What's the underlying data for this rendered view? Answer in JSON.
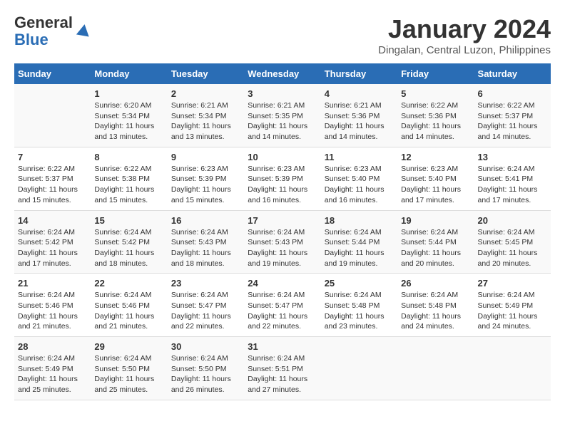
{
  "header": {
    "logo_line1": "General",
    "logo_line2": "Blue",
    "month_title": "January 2024",
    "location": "Dingalan, Central Luzon, Philippines"
  },
  "days_of_week": [
    "Sunday",
    "Monday",
    "Tuesday",
    "Wednesday",
    "Thursday",
    "Friday",
    "Saturday"
  ],
  "weeks": [
    [
      {
        "day": "",
        "info": ""
      },
      {
        "day": "1",
        "info": "Sunrise: 6:20 AM\nSunset: 5:34 PM\nDaylight: 11 hours\nand 13 minutes."
      },
      {
        "day": "2",
        "info": "Sunrise: 6:21 AM\nSunset: 5:34 PM\nDaylight: 11 hours\nand 13 minutes."
      },
      {
        "day": "3",
        "info": "Sunrise: 6:21 AM\nSunset: 5:35 PM\nDaylight: 11 hours\nand 14 minutes."
      },
      {
        "day": "4",
        "info": "Sunrise: 6:21 AM\nSunset: 5:36 PM\nDaylight: 11 hours\nand 14 minutes."
      },
      {
        "day": "5",
        "info": "Sunrise: 6:22 AM\nSunset: 5:36 PM\nDaylight: 11 hours\nand 14 minutes."
      },
      {
        "day": "6",
        "info": "Sunrise: 6:22 AM\nSunset: 5:37 PM\nDaylight: 11 hours\nand 14 minutes."
      }
    ],
    [
      {
        "day": "7",
        "info": "Sunrise: 6:22 AM\nSunset: 5:37 PM\nDaylight: 11 hours\nand 15 minutes."
      },
      {
        "day": "8",
        "info": "Sunrise: 6:22 AM\nSunset: 5:38 PM\nDaylight: 11 hours\nand 15 minutes."
      },
      {
        "day": "9",
        "info": "Sunrise: 6:23 AM\nSunset: 5:39 PM\nDaylight: 11 hours\nand 15 minutes."
      },
      {
        "day": "10",
        "info": "Sunrise: 6:23 AM\nSunset: 5:39 PM\nDaylight: 11 hours\nand 16 minutes."
      },
      {
        "day": "11",
        "info": "Sunrise: 6:23 AM\nSunset: 5:40 PM\nDaylight: 11 hours\nand 16 minutes."
      },
      {
        "day": "12",
        "info": "Sunrise: 6:23 AM\nSunset: 5:40 PM\nDaylight: 11 hours\nand 17 minutes."
      },
      {
        "day": "13",
        "info": "Sunrise: 6:24 AM\nSunset: 5:41 PM\nDaylight: 11 hours\nand 17 minutes."
      }
    ],
    [
      {
        "day": "14",
        "info": "Sunrise: 6:24 AM\nSunset: 5:42 PM\nDaylight: 11 hours\nand 17 minutes."
      },
      {
        "day": "15",
        "info": "Sunrise: 6:24 AM\nSunset: 5:42 PM\nDaylight: 11 hours\nand 18 minutes."
      },
      {
        "day": "16",
        "info": "Sunrise: 6:24 AM\nSunset: 5:43 PM\nDaylight: 11 hours\nand 18 minutes."
      },
      {
        "day": "17",
        "info": "Sunrise: 6:24 AM\nSunset: 5:43 PM\nDaylight: 11 hours\nand 19 minutes."
      },
      {
        "day": "18",
        "info": "Sunrise: 6:24 AM\nSunset: 5:44 PM\nDaylight: 11 hours\nand 19 minutes."
      },
      {
        "day": "19",
        "info": "Sunrise: 6:24 AM\nSunset: 5:44 PM\nDaylight: 11 hours\nand 20 minutes."
      },
      {
        "day": "20",
        "info": "Sunrise: 6:24 AM\nSunset: 5:45 PM\nDaylight: 11 hours\nand 20 minutes."
      }
    ],
    [
      {
        "day": "21",
        "info": "Sunrise: 6:24 AM\nSunset: 5:46 PM\nDaylight: 11 hours\nand 21 minutes."
      },
      {
        "day": "22",
        "info": "Sunrise: 6:24 AM\nSunset: 5:46 PM\nDaylight: 11 hours\nand 21 minutes."
      },
      {
        "day": "23",
        "info": "Sunrise: 6:24 AM\nSunset: 5:47 PM\nDaylight: 11 hours\nand 22 minutes."
      },
      {
        "day": "24",
        "info": "Sunrise: 6:24 AM\nSunset: 5:47 PM\nDaylight: 11 hours\nand 22 minutes."
      },
      {
        "day": "25",
        "info": "Sunrise: 6:24 AM\nSunset: 5:48 PM\nDaylight: 11 hours\nand 23 minutes."
      },
      {
        "day": "26",
        "info": "Sunrise: 6:24 AM\nSunset: 5:48 PM\nDaylight: 11 hours\nand 24 minutes."
      },
      {
        "day": "27",
        "info": "Sunrise: 6:24 AM\nSunset: 5:49 PM\nDaylight: 11 hours\nand 24 minutes."
      }
    ],
    [
      {
        "day": "28",
        "info": "Sunrise: 6:24 AM\nSunset: 5:49 PM\nDaylight: 11 hours\nand 25 minutes."
      },
      {
        "day": "29",
        "info": "Sunrise: 6:24 AM\nSunset: 5:50 PM\nDaylight: 11 hours\nand 25 minutes."
      },
      {
        "day": "30",
        "info": "Sunrise: 6:24 AM\nSunset: 5:50 PM\nDaylight: 11 hours\nand 26 minutes."
      },
      {
        "day": "31",
        "info": "Sunrise: 6:24 AM\nSunset: 5:51 PM\nDaylight: 11 hours\nand 27 minutes."
      },
      {
        "day": "",
        "info": ""
      },
      {
        "day": "",
        "info": ""
      },
      {
        "day": "",
        "info": ""
      }
    ]
  ]
}
